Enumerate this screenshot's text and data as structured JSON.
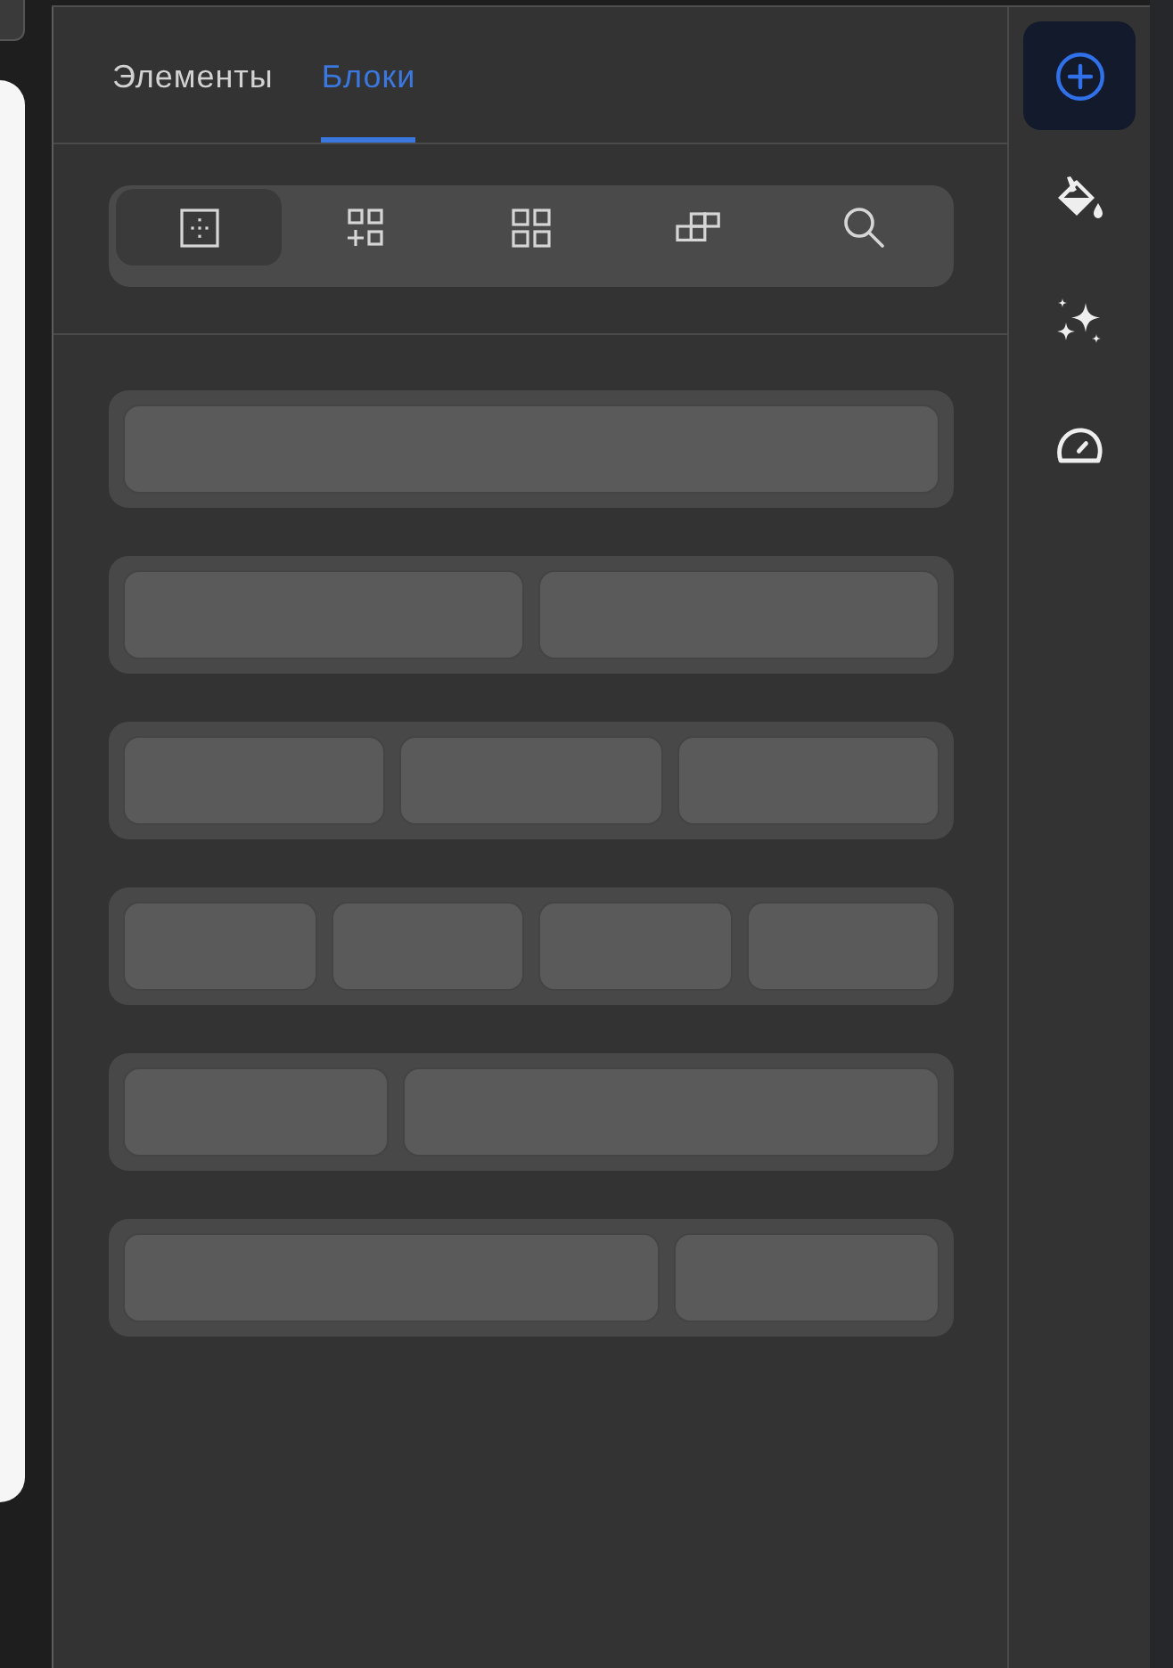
{
  "tabs": [
    {
      "label": "Элементы",
      "selected": false
    },
    {
      "label": "Блоки",
      "selected": true
    }
  ],
  "block_filters": [
    {
      "kind": "layouts",
      "selected": true
    },
    {
      "kind": "add",
      "selected": false
    },
    {
      "kind": "grid",
      "selected": false
    },
    {
      "kind": "stack",
      "selected": false
    },
    {
      "kind": "search",
      "selected": false
    }
  ],
  "layouts": [
    {
      "cells": [
        {
          "kind": "narrow"
        }
      ]
    },
    {
      "cells": [
        {
          "kind": "narrow"
        },
        {
          "kind": "narrow"
        }
      ]
    },
    {
      "cells": [
        {
          "kind": "narrow"
        },
        {
          "kind": "narrow"
        },
        {
          "kind": "narrow"
        }
      ]
    },
    {
      "cells": [
        {
          "kind": "narrow"
        },
        {
          "kind": "narrow"
        },
        {
          "kind": "narrow"
        },
        {
          "kind": "narrow"
        }
      ]
    },
    {
      "cells": [
        {
          "kind": "narrow"
        },
        {
          "kind": "wide"
        }
      ]
    },
    {
      "cells": [
        {
          "kind": "wide"
        },
        {
          "kind": "narrow"
        }
      ]
    }
  ],
  "side_rail": [
    {
      "kind": "add",
      "selected": true
    },
    {
      "kind": "fill",
      "selected": false
    },
    {
      "kind": "effects",
      "selected": false
    },
    {
      "kind": "speed",
      "selected": false
    }
  ]
}
